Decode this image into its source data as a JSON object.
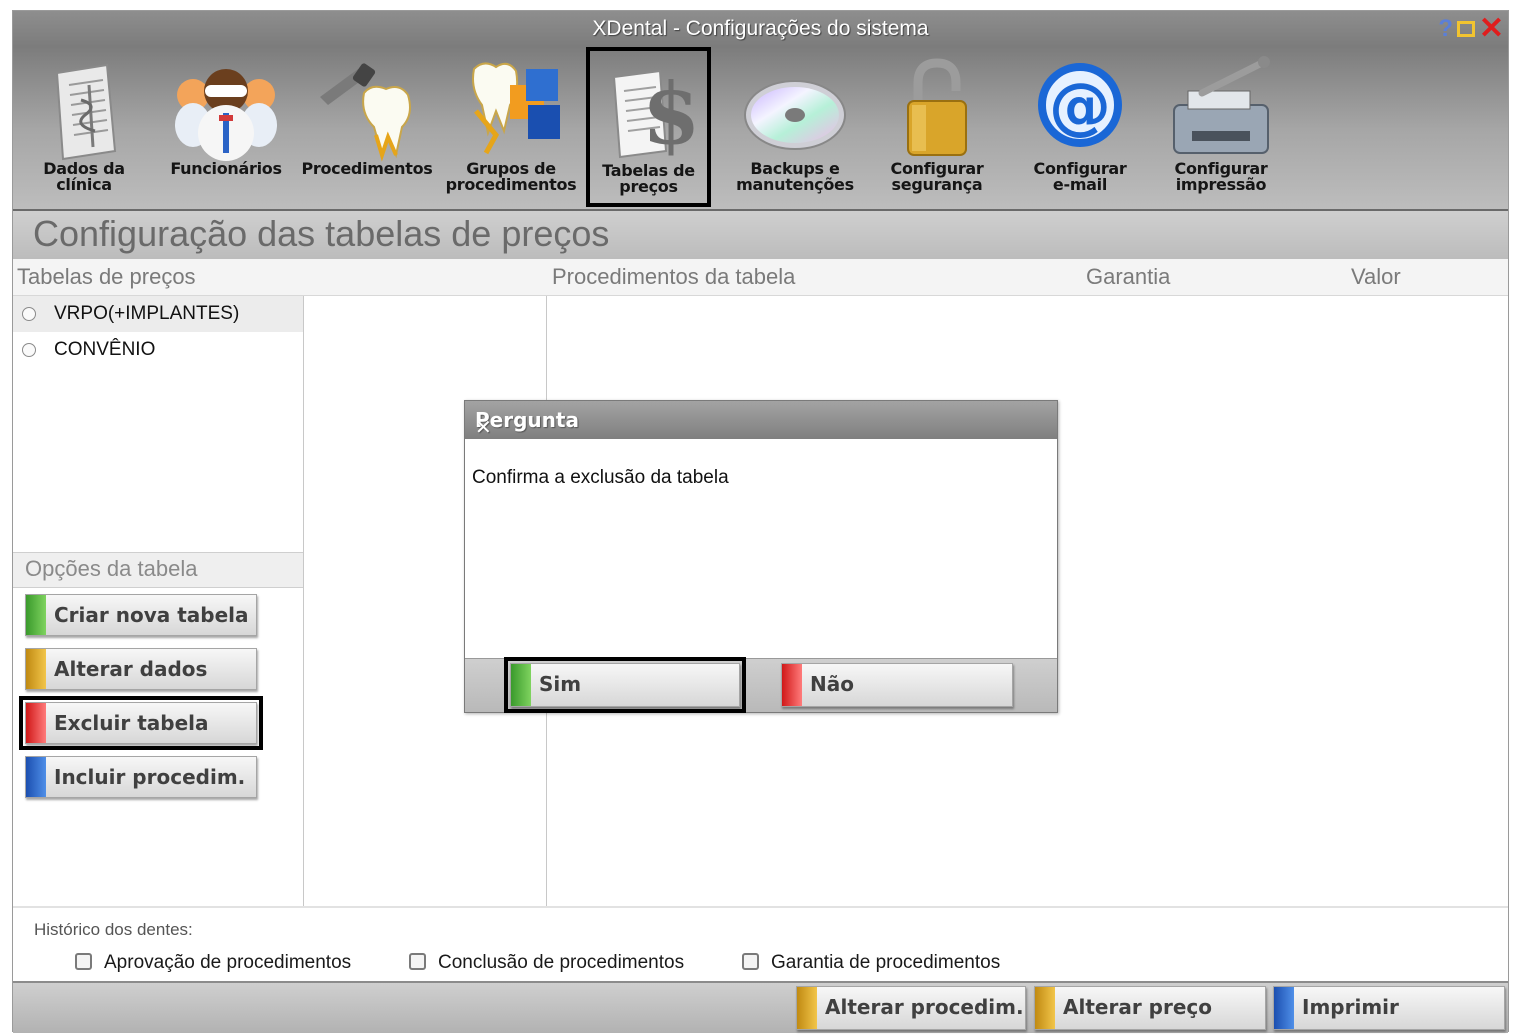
{
  "window": {
    "title": "XDental - Configurações do sistema",
    "help_glyph": "?",
    "close_glyph": "✕"
  },
  "toolbar": {
    "items": [
      {
        "label": "Dados da\nclínica",
        "icon": "document-caduceus-icon"
      },
      {
        "label": "Funcionários",
        "icon": "staff-group-icon"
      },
      {
        "label": "Procedimentos",
        "icon": "dental-tool-tooth-icon"
      },
      {
        "label": "Grupos de\nprocedimentos",
        "icon": "tooth-cubes-icon"
      },
      {
        "label": "Tabelas de\npreços",
        "icon": "price-document-dollar-icon"
      },
      {
        "label": "Backups e\nmanutenções",
        "icon": "cd-disc-icon"
      },
      {
        "label": "Configurar\nsegurança",
        "icon": "padlock-icon"
      },
      {
        "label": "Configurar\ne-mail",
        "icon": "at-sign-icon"
      },
      {
        "label": "Configurar\nimpressão",
        "icon": "printer-wrench-icon"
      }
    ],
    "active_index": 4
  },
  "section": {
    "title": "Configuração das tabelas de preços"
  },
  "columns": {
    "price_tables": "Tabelas de preços",
    "procedures": "Procedimentos da tabela",
    "warranty": "Garantia",
    "value": "Valor"
  },
  "price_tables": [
    {
      "name": "VRPO(+IMPLANTES)"
    },
    {
      "name": "CONVÊNIO"
    }
  ],
  "table_options": {
    "header": "Opções da tabela",
    "create": "Criar nova tabela",
    "edit": "Alterar dados",
    "delete": "Excluir tabela",
    "add_procedure": "Incluir procedim."
  },
  "history": {
    "label": "Histórico dos dentes:",
    "approval": "Aprovação de procedimentos",
    "conclusion": "Conclusão de procedimentos",
    "warranty": "Garantia de procedimentos"
  },
  "bottom_buttons": {
    "edit_procedure": "Alterar procedim.",
    "edit_price": "Alterar preço",
    "print": "Imprimir"
  },
  "dialog": {
    "title": "Pergunta",
    "message": "Confirma a exclusão da tabela",
    "yes": "Sim",
    "no": "Não",
    "close_glyph": "✕"
  },
  "colors": {
    "green": "#5cbf3c",
    "yellow": "#e0a820",
    "red": "#e63030",
    "blue": "#2f6fd0"
  }
}
